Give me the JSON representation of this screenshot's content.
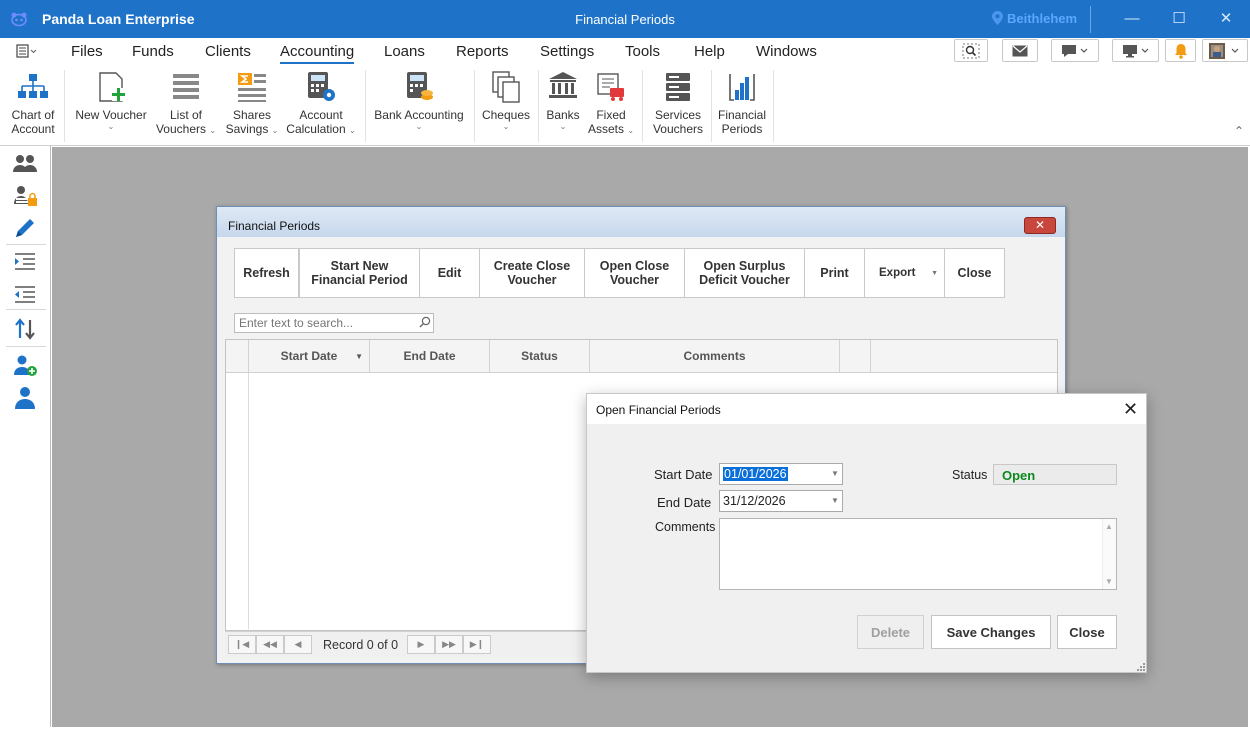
{
  "app": {
    "title": "Panda Loan Enterprise",
    "window_title": "Financial Periods",
    "location": "Beithlehem",
    "accent": "#1e73c8"
  },
  "menu": {
    "items": [
      "Files",
      "Funds",
      "Clients",
      "Accounting",
      "Loans",
      "Reports",
      "Settings",
      "Tools",
      "Help",
      "Windows"
    ],
    "active": "Accounting"
  },
  "ribbon": {
    "chart_of_account": [
      "Chart of",
      "Account"
    ],
    "new_voucher": "New Voucher",
    "list_of_vouchers": [
      "List of",
      "Vouchers"
    ],
    "shares_savings": [
      "Shares",
      "Savings"
    ],
    "account_calculation": [
      "Account",
      "Calculation"
    ],
    "bank_accounting": "Bank Accounting",
    "cheques": "Cheques",
    "banks": "Banks",
    "fixed_assets": [
      "Fixed",
      "Assets"
    ],
    "services_vouchers": [
      "Services",
      "Vouchers"
    ],
    "financial_periods": [
      "Financial",
      "Periods"
    ]
  },
  "fp_window": {
    "title": "Financial Periods",
    "close_x": "✕",
    "toolbar": {
      "refresh": "Refresh",
      "start_new": [
        "Start New",
        "Financial Period"
      ],
      "edit": "Edit",
      "create_close": [
        "Create Close",
        "Voucher"
      ],
      "open_close": [
        "Open Close",
        "Voucher"
      ],
      "open_surplus": [
        "Open Surplus",
        "Deficit Voucher"
      ],
      "print": "Print",
      "export": "Export",
      "close": "Close"
    },
    "search_placeholder": "Enter text to search...",
    "columns": [
      "Start Date",
      "End Date",
      "Status",
      "Comments"
    ],
    "rows": [],
    "record_info": "Record 0 of 0"
  },
  "dialog": {
    "title": "Open Financial Periods",
    "close_x": "✕",
    "start_date_label": "Start Date",
    "start_date": "01/01/2026",
    "end_date_label": "End Date",
    "end_date": "31/12/2026",
    "comments_label": "Comments",
    "comments": "",
    "status_label": "Status",
    "status": "Open",
    "status_color": "#0b8a1e",
    "buttons": {
      "delete": "Delete",
      "save": "Save Changes",
      "close": "Close"
    }
  }
}
